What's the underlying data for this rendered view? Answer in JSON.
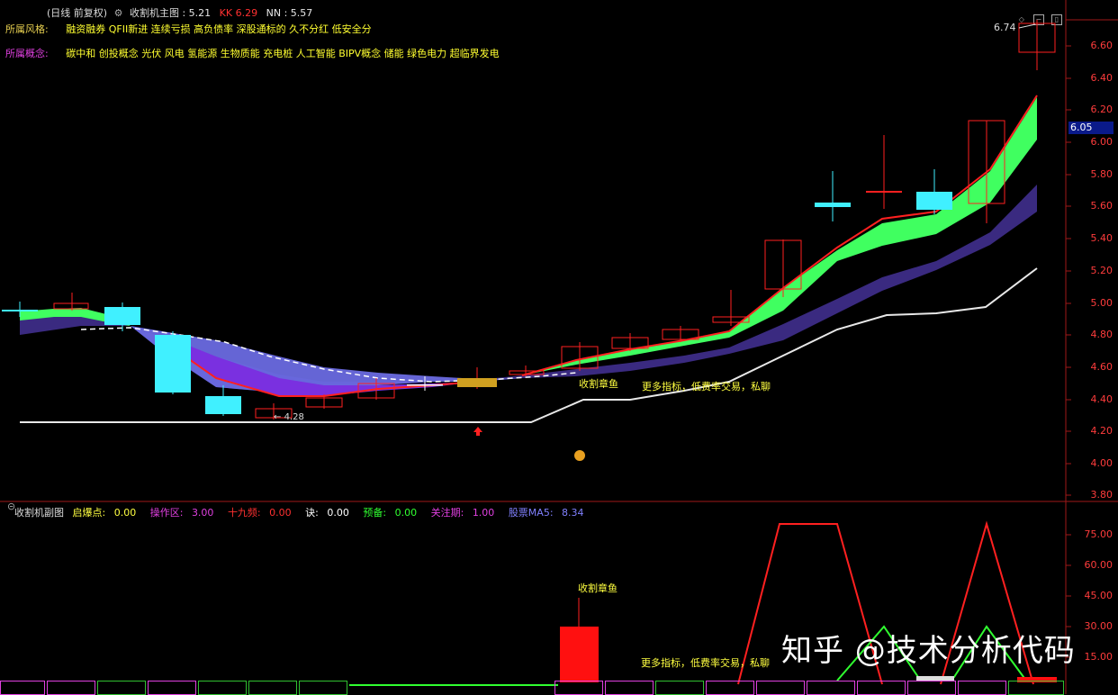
{
  "header": {
    "title_prefix": "(日线 前复权)",
    "indicator_name": "收割机主图",
    "indicator_value": ": 5.21",
    "kk_label": "KK",
    "kk_value": "6.29",
    "nn_label": "NN",
    "nn_value": ": 5.57"
  },
  "info": {
    "style_label": "所属风格:",
    "style_text": "融资融券 QFII新进 连续亏损 高负债率 深股通标的 久不分红 低安全分",
    "concept_label": "所属概念:",
    "concept_text": "碳中和 创投概念 光伏 风电 氢能源 生物质能 充电桩 人工智能 BIPV概念 储能 绿色电力 超临界发电"
  },
  "main_chart": {
    "y_ticks": [
      "6.60",
      "6.40",
      "6.20",
      "6.00",
      "5.80",
      "5.60",
      "5.40",
      "5.20",
      "5.00",
      "4.80",
      "4.60",
      "4.40",
      "4.20",
      "4.00",
      "3.80"
    ],
    "current_price": "6.05",
    "high_label": "6.74",
    "low_label": "4.28",
    "annotation_1": "收割章鱼",
    "annotation_2": "更多指标，低费率交易，私聊"
  },
  "sub_chart": {
    "name": "收割机副图",
    "items": [
      {
        "label": "启爆点:",
        "value": "0.00",
        "color": "#ffff40"
      },
      {
        "label": "操作区:",
        "value": "3.00",
        "color": "#e040e0"
      },
      {
        "label": "十九频:",
        "value": "0.00",
        "color": "#ff3030"
      },
      {
        "label": "诀:",
        "value": "0.00",
        "color": "#ffffff"
      },
      {
        "label": "预备:",
        "value": "0.00",
        "color": "#30ff30"
      },
      {
        "label": "关注期:",
        "value": "1.00",
        "color": "#e040e0"
      },
      {
        "label": "股票MA5:",
        "value": "8.34",
        "color": "#8080ff"
      }
    ],
    "y_ticks": [
      "75.00",
      "60.00",
      "45.00",
      "30.00",
      "15.00"
    ],
    "annotation_1": "收割章鱼",
    "annotation_2": "更多指标，低费率交易，私聊"
  },
  "watermark": "知乎 @技术分析代码",
  "colors": {
    "up": "#ff2020",
    "down": "#40f0ff",
    "band_green": "#40ff60",
    "band_purple": "#3a2a80",
    "band_blue": "#6a6ae0"
  }
}
